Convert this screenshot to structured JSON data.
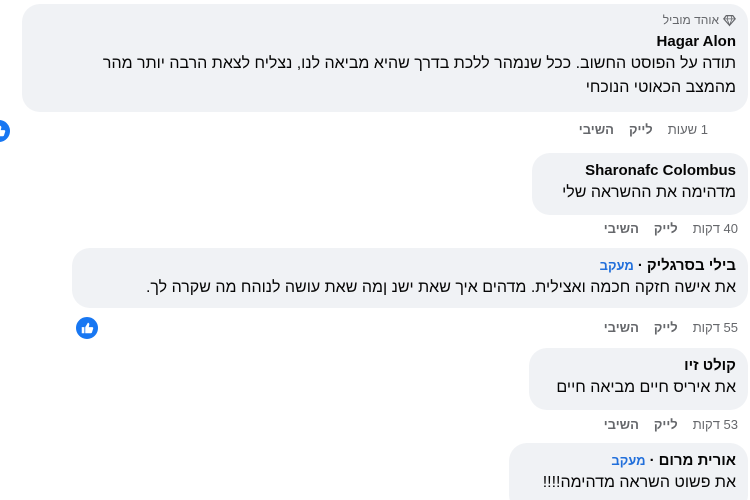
{
  "comments": [
    {
      "badge": "אוהד מוביל",
      "author": "Hagar Alon",
      "text_line1": "תודה על הפוסט החשוב. ככל שנמהר ללכת בדרך שהיא מביאה לנו, נצליח לצאת הרבה יותר מהר",
      "text_line2": "מהמצב הכאוטי הנוכחי",
      "time": "1 שעות",
      "like": "לייק",
      "reply": "השיבי"
    },
    {
      "author": "Sharonafc Colombus",
      "text": "מדהימה את ההשראה שלי",
      "time": "40 דקות",
      "like": "לייק",
      "reply": "השיבי"
    },
    {
      "author": "בילי בסרגליק",
      "follow": "מעקב",
      "text": "את אישה חזקה חכמה ואצילית. מדהים איך שאת ישנ ןמה שאת עושה לנוהח מה שקרה לך.",
      "time": "55 דקות",
      "like": "לייק",
      "reply": "השיבי"
    },
    {
      "author": "קולט זיו",
      "text": "את איריס חיים מביאה חיים",
      "time": "53 דקות",
      "like": "לייק",
      "reply": "השיבי"
    },
    {
      "author": "אורית מרום",
      "follow": "מעקב",
      "text": "את פשוט השראה מדהימה!!!!"
    }
  ],
  "icons": {
    "badge": "diamond-icon",
    "reaction": "thumbs-up-icon"
  },
  "colors": {
    "bubble": "#f0f2f5",
    "follow": "#216fdb",
    "reaction": "#1877f2"
  }
}
